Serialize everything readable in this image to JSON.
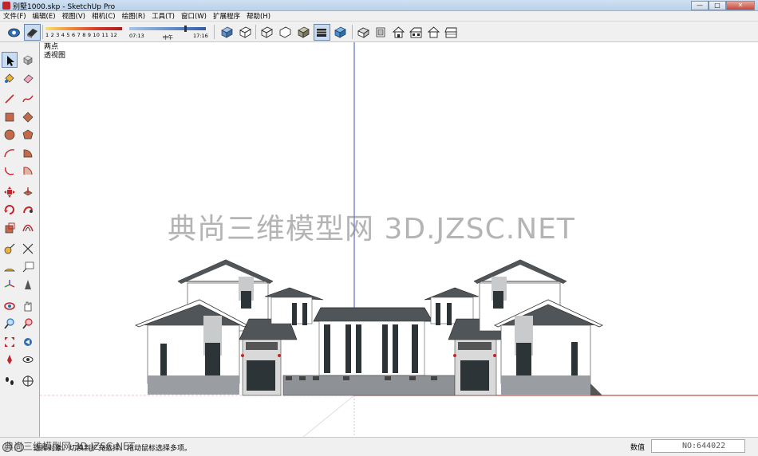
{
  "window": {
    "title": "别墅1000.skp - SketchUp Pro",
    "buttons": {
      "minimize": "—",
      "maximize": "□",
      "close": "✕"
    }
  },
  "menu": [
    "文件(F)",
    "编辑(E)",
    "视图(V)",
    "相机(C)",
    "绘图(R)",
    "工具(T)",
    "窗口(W)",
    "扩展程序",
    "帮助(H)"
  ],
  "toolbar": {
    "shadow_months": "1 2 3 4 5 6 7 8 9 10 11 12",
    "time_start": "07:13",
    "time_mid": "中午",
    "time_end": "17:16",
    "time_level": 0.72,
    "buttons": [
      "styles-icon",
      "shadows-icon",
      "xray-icon",
      "back-edges-icon",
      "wireframe-icon",
      "hidden-line-icon",
      "shaded-icon",
      "shaded-textures-icon",
      "monochrome-icon",
      "iso-view-icon",
      "top-view-icon",
      "front-view-icon",
      "right-view-icon",
      "back-view-icon",
      "left-view-icon"
    ]
  },
  "left_tools": [
    "select-icon",
    "component-icon",
    "paint-bucket-icon",
    "eraser-icon",
    "line-icon",
    "freehand-icon",
    "rectangle-icon",
    "rotated-rectangle-icon",
    "circle-icon",
    "polygon-icon",
    "arc-icon",
    "pie-icon",
    "two-point-arc-icon",
    "three-point-arc-icon",
    "move-icon",
    "push-pull-icon",
    "rotate-icon",
    "follow-me-icon",
    "scale-icon",
    "offset-icon",
    "tape-measure-icon",
    "dimension-icon",
    "protractor-icon",
    "text-icon",
    "axes-icon",
    "3d-text-icon",
    "orbit-icon",
    "pan-icon",
    "zoom-icon",
    "zoom-window-icon",
    "zoom-extents-icon",
    "previous-icon",
    "position-camera-icon",
    "look-around-icon",
    "walk-icon",
    "section-plane-icon"
  ],
  "viewport": {
    "scene_label_line1": "两点",
    "scene_label_line2": "透视图",
    "watermark": "典尚三维模型网 3D.JZSC.NET"
  },
  "status": {
    "hint": "选择对象。切换到扩充选择。拖动鼠标选择多项。",
    "watermark": "典尚三维模型网 3D.JZSC.NET",
    "measure_label": "数值",
    "measure_value": "NO:644022"
  },
  "colors": {
    "accent": "#c9dbf0",
    "axis_blue": "#3a4fbf",
    "axis_red": "#b22222",
    "roof": "#4f5558"
  }
}
